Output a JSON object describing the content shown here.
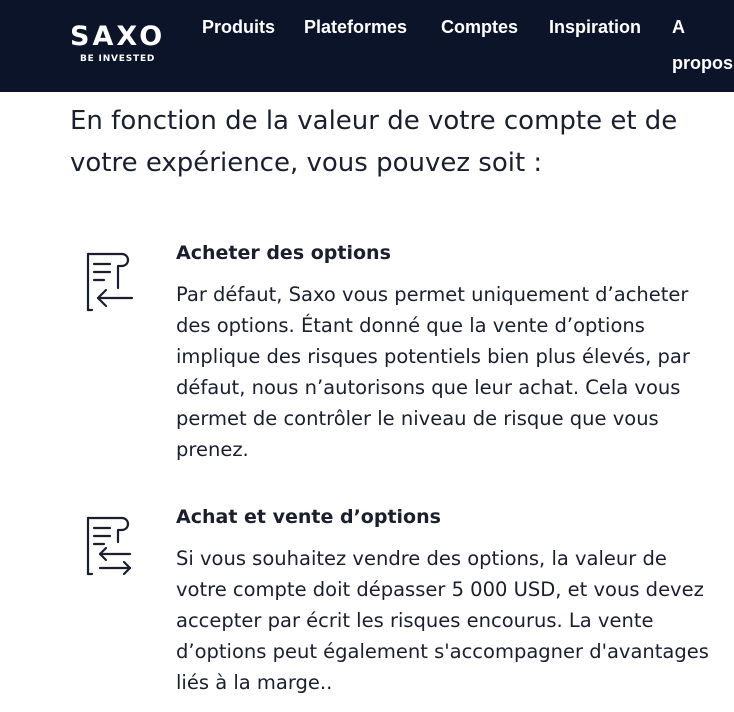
{
  "nav": {
    "logo_word": "SAXO",
    "logo_tagline": "BE INVESTED",
    "links": [
      "Produits",
      "Plateformes",
      "Comptes",
      "Inspiration",
      "A propos"
    ]
  },
  "main": {
    "heading": "En fonction de la valeur de votre compte et de votre expérience, vous pouvez soit :",
    "items": [
      {
        "icon": "document-arrow-left-icon",
        "title": "Acheter des options",
        "text": "Par défaut, Saxo vous permet uniquement d’acheter des options. Étant donné que la vente d’options implique des risques potentiels bien plus élevés, par défaut, nous n’autorisons que leur achat. Cela vous permet de contrôler le niveau de risque que vous prenez."
      },
      {
        "icon": "document-arrows-exchange-icon",
        "title": "Achat et vente d’options",
        "text": "Si vous souhaitez vendre des options, la valeur de votre compte doit dépasser 5 000 USD, et vous devez accepter par écrit les risques encourus. La vente d’options peut également s'accompagner d'avantages liés à la marge.."
      }
    ]
  },
  "colors": {
    "nav_background": "#0b1428",
    "nav_text": "#ffffff",
    "body_text": "#1a1f2e",
    "page_background": "#ffffff"
  }
}
